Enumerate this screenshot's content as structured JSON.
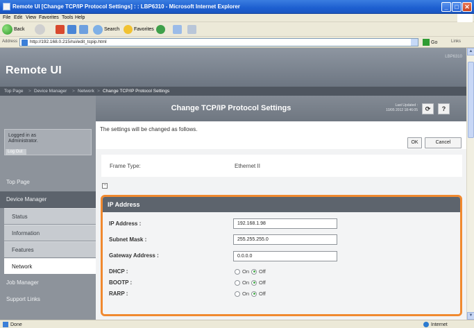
{
  "window": {
    "title": "Remote UI [Change TCP/IP Protocol Settings] : : LBP6310 - Microsoft Internet Explorer",
    "controls": {
      "minimize": "_",
      "maximize": "□",
      "close": "✕"
    }
  },
  "menu": [
    "File",
    "Edit",
    "View",
    "Favorites",
    "Tools",
    "Help"
  ],
  "toolbar": {
    "back": "Back",
    "search": "Search",
    "favorites": "Favorites"
  },
  "address": {
    "label": "Address",
    "url": "http://192.168.0.215/rui/edit_tcpip.html",
    "go": "Go",
    "links": "Links"
  },
  "status": {
    "left": "Done",
    "zone": "Internet"
  },
  "remoteui": {
    "logo": "Remote UI",
    "model": "LBP6310",
    "breadcrumb": [
      "Top Page",
      "Device Manager",
      "Network",
      "Change TCP/IP Protocol Settings"
    ],
    "sidebar": {
      "login_text": "Logged in as Administrator.",
      "logout": "Log Out",
      "top_page": "Top Page",
      "device_manager": "Device Manager",
      "items": [
        "Status",
        "Information",
        "Features",
        "Network"
      ],
      "job_manager": "Job Manager",
      "support_links": "Support Links"
    },
    "page_title": "Change TCP/IP Protocol Settings",
    "last_updated_label": "Last Updated :",
    "last_updated_value": "10/05 2012 18:46:05",
    "refresh_icon": "refresh-icon",
    "help_label": "?",
    "message": "The settings will be changed as follows.",
    "ok": "OK",
    "cancel": "Cancel",
    "frame_type_label": "Frame Type:",
    "frame_type_value": "Ethernet II",
    "collapse_toggle": "−",
    "ip_section": {
      "title": "IP Address",
      "ip_label": "IP Address :",
      "ip_value": "192.168.1.98",
      "mask_label": "Subnet Mask :",
      "mask_value": "255.255.255.0",
      "gateway_label": "Gateway Address :",
      "gateway_value": "0.0.0.0",
      "dhcp_label": "DHCP :",
      "bootp_label": "BOOTP :",
      "rarp_label": "RARP :",
      "on": "On",
      "off": "Off"
    },
    "accent_color": "#f0892f"
  }
}
